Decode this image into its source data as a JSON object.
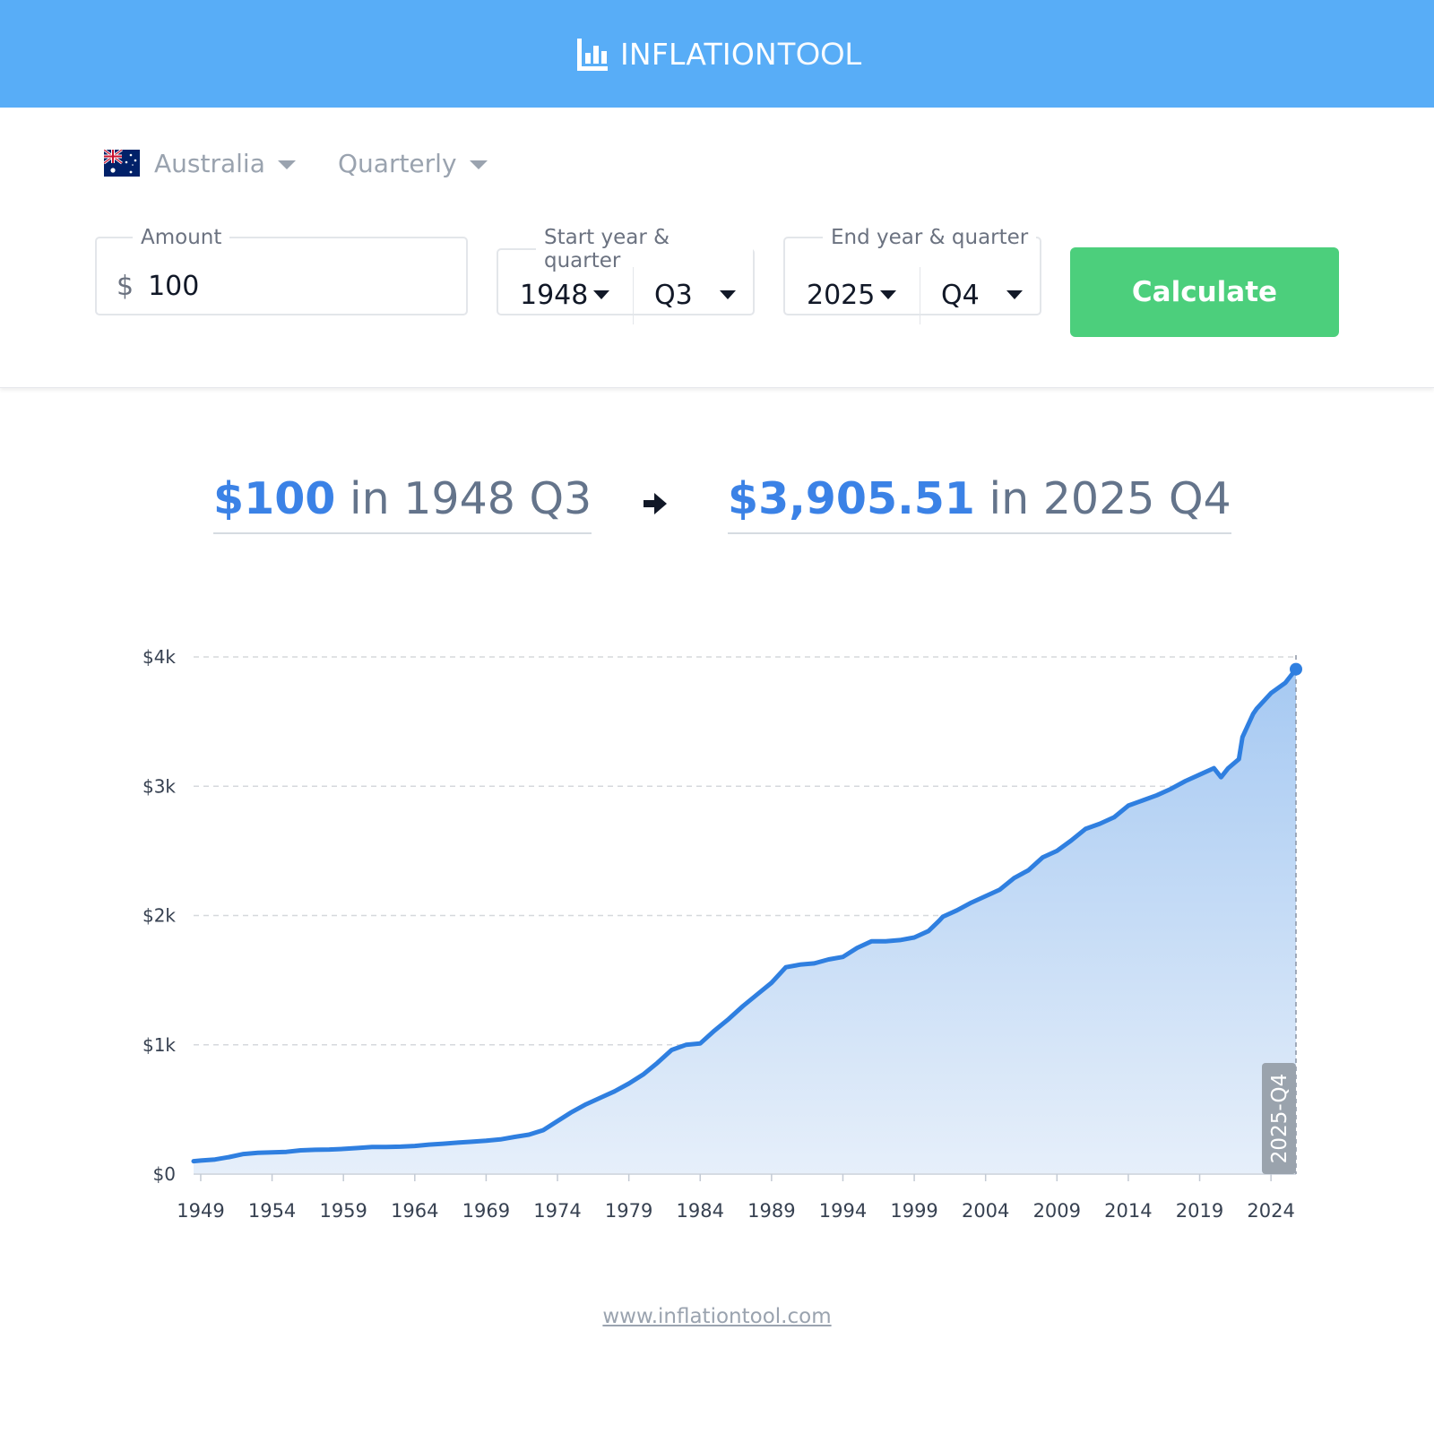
{
  "header": {
    "logo_bold": "INFLATION",
    "logo_light": "TOOL",
    "logo_icon": "bar-chart-icon",
    "background_color": "#58adf7"
  },
  "selectors": {
    "country": "Australia",
    "frequency": "Quarterly"
  },
  "form": {
    "amount_legend": "Amount",
    "currency_symbol": "$",
    "amount_value": "100",
    "start_legend": "Start year & quarter",
    "start_year": "1948",
    "start_quarter": "Q3",
    "end_legend": "End year & quarter",
    "end_year": "2025",
    "end_quarter": "Q4",
    "calculate_label": "Calculate",
    "calculate_color": "#4ccf7c"
  },
  "result": {
    "from_amount": "$100",
    "from_period": "in 1948 Q3",
    "to_amount": "$3,905.51",
    "to_period": "in 2025 Q4",
    "accent_color": "#3b82e6"
  },
  "chart_data": {
    "type": "area",
    "x_tick_labels": [
      "1949",
      "1954",
      "1959",
      "1964",
      "1969",
      "1974",
      "1979",
      "1984",
      "1989",
      "1994",
      "1999",
      "2004",
      "2009",
      "2014",
      "2019",
      "2024"
    ],
    "y_tick_labels": [
      "$0",
      "$1k",
      "$2k",
      "$3k",
      "$4k"
    ],
    "ylim": [
      0,
      4000
    ],
    "xlim": [
      1948.5,
      2025.75
    ],
    "grid": true,
    "marker_label": "2025-Q4",
    "line_color": "#2f7fe0",
    "series": [
      {
        "x": [
          1948.5,
          1949,
          1950,
          1951,
          1952,
          1953,
          1954,
          1955,
          1956,
          1957,
          1958,
          1959,
          1960,
          1961,
          1962,
          1963,
          1964,
          1965,
          1966,
          1967,
          1968,
          1969,
          1970,
          1971,
          1972,
          1973,
          1974,
          1975,
          1976,
          1977,
          1978,
          1979,
          1980,
          1981,
          1982,
          1983,
          1984,
          1985,
          1986,
          1987,
          1988,
          1989,
          1990,
          1991,
          1992,
          1993,
          1994,
          1995,
          1996,
          1997,
          1998,
          1999,
          2000,
          2000.75,
          2001,
          2002,
          2003,
          2004,
          2005,
          2006,
          2007,
          2008,
          2009,
          2010,
          2011,
          2012,
          2013,
          2014,
          2015,
          2016,
          2017,
          2018,
          2019,
          2020,
          2020.5,
          2021,
          2021.75,
          2022,
          2022.75,
          2023,
          2024,
          2025,
          2025.75
        ],
        "values": [
          100,
          105,
          113,
          132,
          155,
          165,
          168,
          172,
          184,
          188,
          190,
          195,
          202,
          210,
          210,
          212,
          218,
          228,
          235,
          243,
          250,
          258,
          268,
          288,
          305,
          340,
          410,
          480,
          540,
          590,
          640,
          700,
          770,
          860,
          960,
          1000,
          1010,
          1110,
          1200,
          1300,
          1390,
          1480,
          1600,
          1620,
          1630,
          1660,
          1680,
          1750,
          1800,
          1800,
          1810,
          1830,
          1880,
          1960,
          1990,
          2040,
          2100,
          2150,
          2200,
          2290,
          2350,
          2450,
          2500,
          2580,
          2670,
          2710,
          2760,
          2850,
          2890,
          2930,
          2980,
          3040,
          3090,
          3140,
          3070,
          3140,
          3210,
          3380,
          3560,
          3600,
          3720,
          3800,
          3905.51
        ]
      }
    ]
  },
  "footer": {
    "link_text": "www.inflationtool.com"
  }
}
